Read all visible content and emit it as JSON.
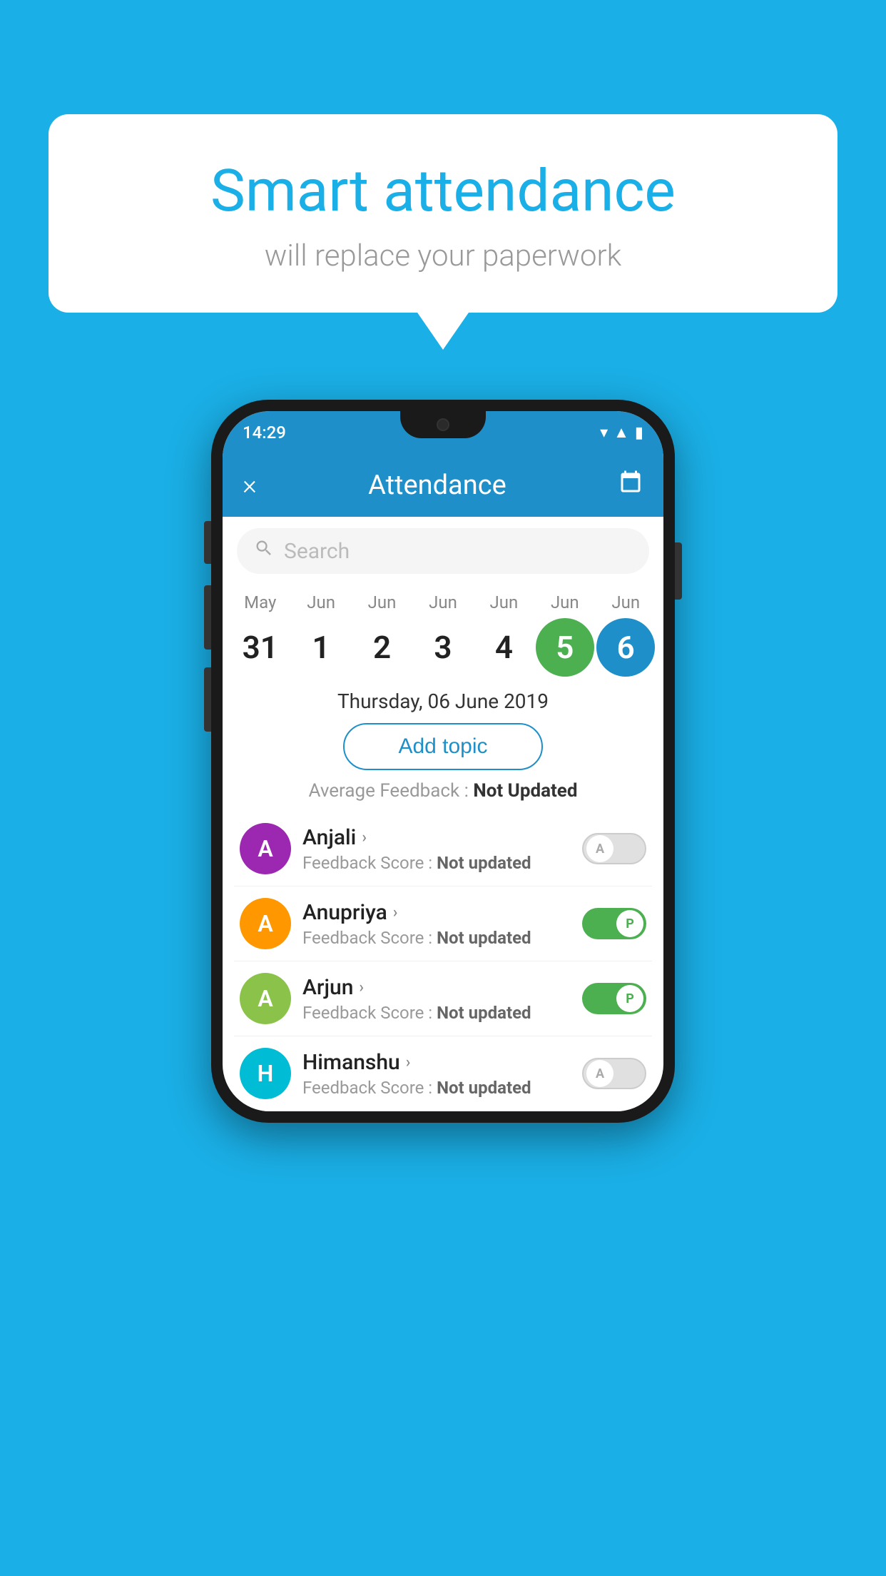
{
  "background_color": "#1AAFE6",
  "speech_bubble": {
    "title": "Smart attendance",
    "subtitle": "will replace your paperwork"
  },
  "phone": {
    "status_bar": {
      "time": "14:29",
      "icons": [
        "wifi",
        "signal",
        "battery"
      ]
    },
    "app_bar": {
      "close_label": "×",
      "title": "Attendance",
      "calendar_icon": "📅"
    },
    "search": {
      "placeholder": "Search"
    },
    "calendar": {
      "days": [
        {
          "month": "May",
          "date": "31",
          "state": "normal"
        },
        {
          "month": "Jun",
          "date": "1",
          "state": "normal"
        },
        {
          "month": "Jun",
          "date": "2",
          "state": "normal"
        },
        {
          "month": "Jun",
          "date": "3",
          "state": "normal"
        },
        {
          "month": "Jun",
          "date": "4",
          "state": "normal"
        },
        {
          "month": "Jun",
          "date": "5",
          "state": "today"
        },
        {
          "month": "Jun",
          "date": "6",
          "state": "selected"
        }
      ]
    },
    "selected_date": "Thursday, 06 June 2019",
    "add_topic_label": "Add topic",
    "avg_feedback_label": "Average Feedback :",
    "avg_feedback_value": "Not Updated",
    "students": [
      {
        "name": "Anjali",
        "avatar_letter": "A",
        "avatar_color": "purple",
        "feedback_label": "Feedback Score :",
        "feedback_value": "Not updated",
        "toggle_state": "off",
        "toggle_label": "A"
      },
      {
        "name": "Anupriya",
        "avatar_letter": "A",
        "avatar_color": "orange",
        "feedback_label": "Feedback Score :",
        "feedback_value": "Not updated",
        "toggle_state": "on",
        "toggle_label": "P"
      },
      {
        "name": "Arjun",
        "avatar_letter": "A",
        "avatar_color": "light-green",
        "feedback_label": "Feedback Score :",
        "feedback_value": "Not updated",
        "toggle_state": "on",
        "toggle_label": "P"
      },
      {
        "name": "Himanshu",
        "avatar_letter": "H",
        "avatar_color": "teal",
        "feedback_label": "Feedback Score :",
        "feedback_value": "Not updated",
        "toggle_state": "off",
        "toggle_label": "A"
      }
    ]
  }
}
